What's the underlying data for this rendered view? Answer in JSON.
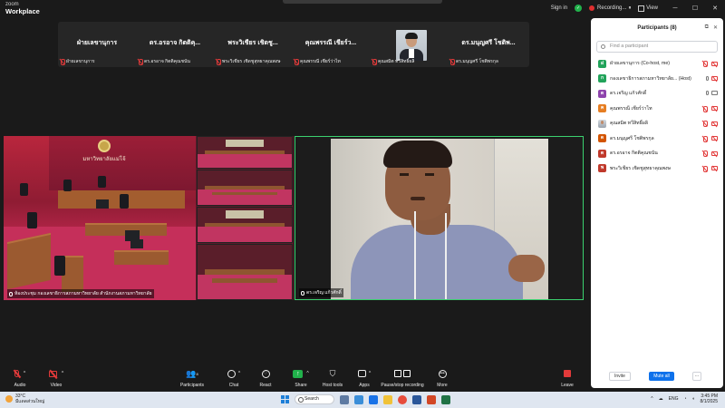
{
  "app": {
    "logo_top": "zoom",
    "logo_bottom": "Workplace"
  },
  "titlebar": {
    "signin": "Sign in",
    "recording": "Recording...",
    "view": "View"
  },
  "gallery": [
    {
      "name": "ฝ่ายเลขานุการ",
      "label": "ฝ่ายเลขานุการ"
    },
    {
      "name": "ดร.อรอาจ  กิตติคุ...",
      "label": "ดร.อรอาจ  กิตติคุณชนัน"
    },
    {
      "name": "พระวิเชียร  เชิดชู...",
      "label": "พระวิเชียร  เชิดชูสุทธาคุณพงษ"
    },
    {
      "name": "คุณพรรณี  เชียร์ว...",
      "label": "คุณพรรณี  เชียร์ว่าไท"
    },
    {
      "name": "",
      "label": "คุณสมิต  ทวีสิทธิ์ผลิ"
    },
    {
      "name": "ดร.มนุญศรี  โชติพ...",
      "label": "ดร.มนุญศรี  โชติพรกุล"
    }
  ],
  "videos": {
    "left_label": "ห้องประชุม กองเลขาธิการสภามหาวิทยาลัย สำนักงานสภามหาวิทยาลัย",
    "left_banner": "มหาวิทยาลัยแม่โจ้",
    "right_label": "ดร.เจริญ  แก้วศักดิ์"
  },
  "participants_panel": {
    "title": "Participants (8)",
    "search_placeholder": "Find a participant",
    "items": [
      {
        "initial": "ฝ",
        "color": "#21a35a",
        "name": "ฝ่ายเลขานุการ (Co-host, me)",
        "mic": "off",
        "cam": "off"
      },
      {
        "initial": "ก",
        "color": "#21a35a",
        "name": "กองเลขาธิการสภามหาวิทยาลัย... (Host)",
        "mic": "on",
        "cam": "off"
      },
      {
        "initial": "ด",
        "color": "#8e44ad",
        "name": "ดร.เจริญ  แก้วศักดิ์",
        "mic": "on",
        "cam": "on"
      },
      {
        "initial": "ค",
        "color": "#e67e22",
        "name": "คุณพรรณี  เชียร์ว่าไท",
        "mic": "off",
        "cam": "off"
      },
      {
        "initial": "",
        "color": "photo",
        "name": "คุณสมิต  ทวีสิทธิ์ผลิ",
        "mic": "off",
        "cam": "off"
      },
      {
        "initial": "ด",
        "color": "#d35400",
        "name": "ดร.มนุญศรี  โชติพรกุล",
        "mic": "off",
        "cam": "off"
      },
      {
        "initial": "ด",
        "color": "#c0392b",
        "name": "ดร.อรอาจ  กิตติคุณชนัน",
        "mic": "off",
        "cam": "off"
      },
      {
        "initial": "พ",
        "color": "#c0392b",
        "name": "พระวิเชียร  เชิดชูสุทธาคุณพงษ",
        "mic": "off",
        "cam": "off"
      }
    ],
    "invite": "Invite",
    "mute_all": "Mute all",
    "more": "..."
  },
  "toolbar": {
    "audio": "Audio",
    "video": "Video",
    "participants": "Participants",
    "participants_count": "8",
    "chat": "Chat",
    "react": "React",
    "share": "Share",
    "host_tools": "Host tools",
    "apps": "Apps",
    "pause_stop": "Pause/stop recording",
    "more": "More",
    "leave": "Leave"
  },
  "taskbar": {
    "temp": "33°C",
    "weather_text": "มีแดดส่วนใหญ่",
    "search": "Search",
    "lang": "ENG",
    "time": "3:45 PM",
    "date": "8/1/2025"
  }
}
